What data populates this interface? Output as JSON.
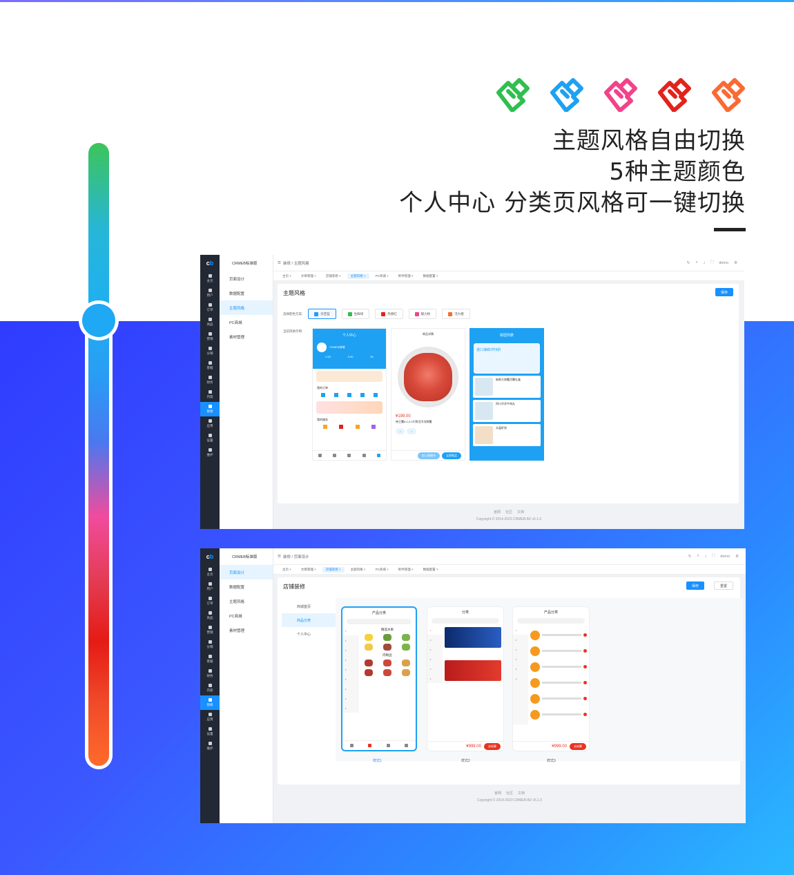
{
  "headline": {
    "line1": "主题风格自由切换",
    "line2": "5种主题颜色",
    "line3": "个人中心 分类页风格可一键切换"
  },
  "theme_colors": [
    "#2fbf4f",
    "#1ea1f3",
    "#f1438a",
    "#e3221c",
    "#fa6a32"
  ],
  "slider": {
    "level": 0.28
  },
  "window1": {
    "brand": "CRMEB标准版",
    "sidebar": [
      "主页",
      "用户",
      "订单",
      "商品",
      "营销",
      "分销",
      "客服",
      "财务",
      "内容",
      "装修",
      "应用",
      "设置",
      "维护"
    ],
    "submenu": [
      "页面设计",
      "数据配置",
      "主题风格",
      "PC商城",
      "素材管理"
    ],
    "breadcrumb": [
      "装修",
      "主题风格"
    ],
    "user": "demo",
    "tabs": [
      "主页",
      "文章管理",
      "店铺装修",
      "主题风格",
      "PC商城",
      "附件管理",
      "数据配置"
    ],
    "panel_title": "主题风格",
    "save_label": "保存",
    "scheme_label": "选择配色方案:",
    "preview_label": "当前风格示例:",
    "schemes": [
      "天空蓝",
      "生鲜绿",
      "热情红",
      "魅力粉",
      "活力橙"
    ],
    "phone1": {
      "title": "个人中心",
      "name": "CRMEB商城",
      "stats": [
        "0.00",
        "0.00",
        "25"
      ],
      "menu": [
        "我的订单",
        "订单中心",
        "我的服务"
      ]
    },
    "phone2": {
      "title": "商品详情",
      "price": "¥199.00",
      "name": "帝王蟹6.0-2.0斤鲜活冷冻鲜蟹",
      "buy": "立即购买",
      "cart": "加入购物车"
    },
    "phone3": {
      "title": "拼团列表",
      "banner": "进口海鲜2件8折",
      "items": [
        "新鲜大闸蟹活蟹礼盒",
        "四川冷冻牛肉丸",
        "水晶虾饺"
      ]
    },
    "footer_links": [
      "官网",
      "社区",
      "文档"
    ],
    "copyright": "Copyright © 2014-2023 CRMEB-BZ v5.1.0"
  },
  "window2": {
    "brand": "CRMEB标准版",
    "sidebar": [
      "主页",
      "用户",
      "订单",
      "商品",
      "营销",
      "分销",
      "客服",
      "财务",
      "内容",
      "装修",
      "应用",
      "设置",
      "维护"
    ],
    "submenu": [
      "页面设计",
      "数据配置",
      "主题风格",
      "PC商城",
      "素材管理"
    ],
    "breadcrumb": [
      "装修",
      "页面设计"
    ],
    "user": "demo",
    "tabs": [
      "主页",
      "文章管理",
      "店铺装修",
      "主题风格",
      "PC商城",
      "附件管理",
      "数据配置"
    ],
    "panel_title": "店铺装修",
    "save_label": "保存",
    "reset_label": "重置",
    "side_tabs": [
      "商城首页",
      "商品分类",
      "个人中心"
    ],
    "style_labels": [
      "样式1",
      "样式2",
      "样式3"
    ],
    "phone_a": {
      "title": "产品分类",
      "section": "精选水果",
      "section2": "肉制品"
    },
    "phone_b": {
      "title": "分类",
      "price": "¥999.00",
      "btn": "去结算"
    },
    "phone_c": {
      "title": "产品分类",
      "price": "¥999.00",
      "btn": "去结算"
    },
    "footer_links": [
      "官网",
      "社区",
      "文档"
    ],
    "copyright": "Copyright © 2014-2023 CRMEB-BZ v5.1.0"
  }
}
